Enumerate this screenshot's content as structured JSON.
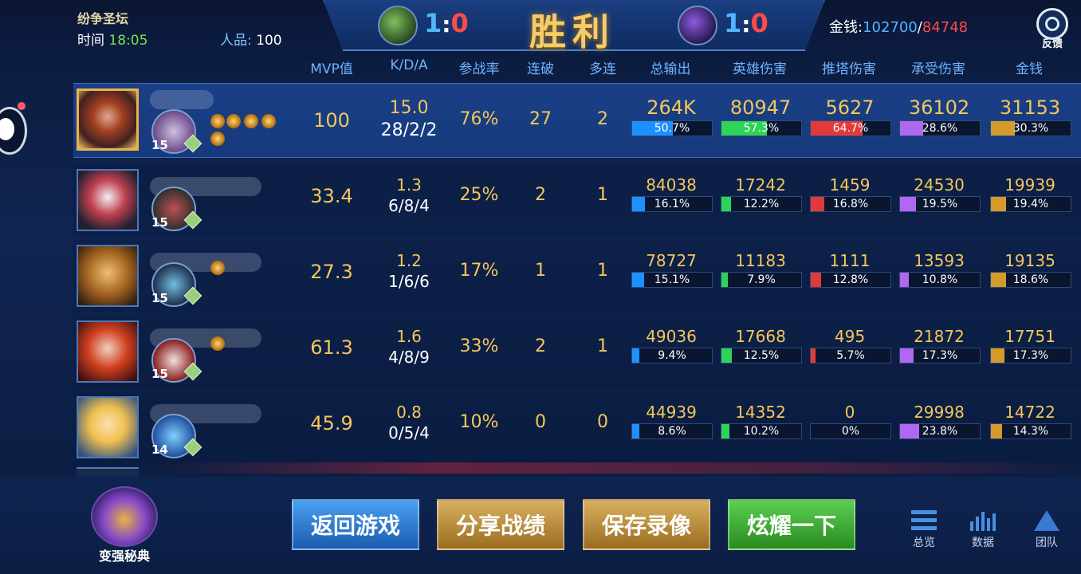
{
  "header": {
    "mode": "纷争圣坛",
    "time_label": "时间",
    "time_value": "18:05",
    "rep_label": "人品:",
    "rep_value": "100",
    "result": "胜利",
    "left_score": {
      "a": "1",
      "b": "0"
    },
    "right_score": {
      "a": "1",
      "b": "0"
    },
    "money_label": "金钱:",
    "money_blue": "102700",
    "money_sep": "/",
    "money_red": "84748",
    "feedback_label": "反馈"
  },
  "columns": [
    "MVP值",
    "K/D/A",
    "参战率",
    "连破",
    "多连",
    "总输出",
    "英雄伤害",
    "推塔伤害",
    "承受伤害",
    "金钱"
  ],
  "players": [
    {
      "level": "15",
      "mvp": "100",
      "kda_score": "15.0",
      "kda": "28/2/2",
      "participation": "76%",
      "streak": "27",
      "multi": "2",
      "output": "264K",
      "output_pct": "50.7%",
      "output_frac": 0.507,
      "hero_dmg": "80947",
      "hero_pct": "57.3%",
      "hero_frac": 0.573,
      "tower_dmg": "5627",
      "tower_pct": "64.7%",
      "tower_frac": 0.647,
      "taken": "36102",
      "taken_pct": "28.6%",
      "taken_frac": 0.286,
      "gold": "31153",
      "gold_pct": "30.3%",
      "gold_frac": 0.303,
      "medals": 5
    },
    {
      "level": "15",
      "mvp": "33.4",
      "kda_score": "1.3",
      "kda": "6/8/4",
      "participation": "25%",
      "streak": "2",
      "multi": "1",
      "output": "84038",
      "output_pct": "16.1%",
      "output_frac": 0.161,
      "hero_dmg": "17242",
      "hero_pct": "12.2%",
      "hero_frac": 0.122,
      "tower_dmg": "1459",
      "tower_pct": "16.8%",
      "tower_frac": 0.168,
      "taken": "24530",
      "taken_pct": "19.5%",
      "taken_frac": 0.195,
      "gold": "19939",
      "gold_pct": "19.4%",
      "gold_frac": 0.194,
      "medals": 0
    },
    {
      "level": "15",
      "mvp": "27.3",
      "kda_score": "1.2",
      "kda": "1/6/6",
      "participation": "17%",
      "streak": "1",
      "multi": "1",
      "output": "78727",
      "output_pct": "15.1%",
      "output_frac": 0.151,
      "hero_dmg": "11183",
      "hero_pct": "7.9%",
      "hero_frac": 0.079,
      "tower_dmg": "1111",
      "tower_pct": "12.8%",
      "tower_frac": 0.128,
      "taken": "13593",
      "taken_pct": "10.8%",
      "taken_frac": 0.108,
      "gold": "19135",
      "gold_pct": "18.6%",
      "gold_frac": 0.186,
      "medals": 1
    },
    {
      "level": "15",
      "mvp": "61.3",
      "kda_score": "1.6",
      "kda": "4/8/9",
      "participation": "33%",
      "streak": "2",
      "multi": "1",
      "output": "49036",
      "output_pct": "9.4%",
      "output_frac": 0.094,
      "hero_dmg": "17668",
      "hero_pct": "12.5%",
      "hero_frac": 0.125,
      "tower_dmg": "495",
      "tower_pct": "5.7%",
      "tower_frac": 0.057,
      "taken": "21872",
      "taken_pct": "17.3%",
      "taken_frac": 0.173,
      "gold": "17751",
      "gold_pct": "17.3%",
      "gold_frac": 0.173,
      "medals": 1
    },
    {
      "level": "14",
      "mvp": "45.9",
      "kda_score": "0.8",
      "kda": "0/5/4",
      "participation": "10%",
      "streak": "0",
      "multi": "0",
      "output": "44939",
      "output_pct": "8.6%",
      "output_frac": 0.086,
      "hero_dmg": "14352",
      "hero_pct": "10.2%",
      "hero_frac": 0.102,
      "tower_dmg": "0",
      "tower_pct": "0%",
      "tower_frac": 0,
      "taken": "29998",
      "taken_pct": "23.8%",
      "taken_frac": 0.238,
      "gold": "14722",
      "gold_pct": "14.3%",
      "gold_frac": 0.143,
      "medals": 0
    }
  ],
  "footer": {
    "guide_label": "变强秘典",
    "buttons": [
      "返回游戏",
      "分享战绩",
      "保存录像",
      "炫耀一下"
    ],
    "nav": [
      "总览",
      "数据",
      "团队"
    ]
  }
}
